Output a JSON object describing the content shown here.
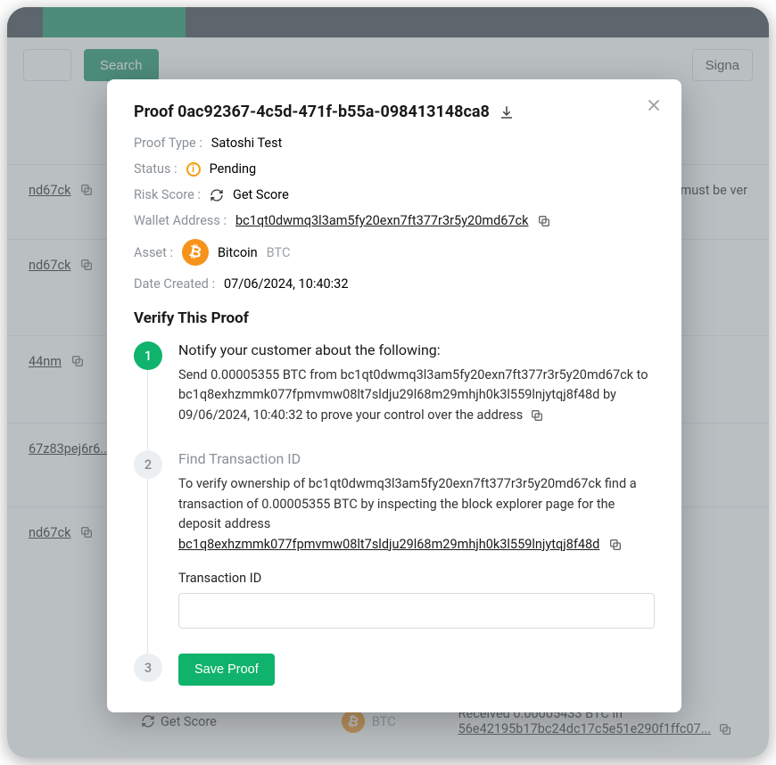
{
  "toolbar": {
    "search_button": "Search",
    "signa_button": "Signa"
  },
  "bg": {
    "addr1": "nd67ck",
    "must_verify": "ck must be ver",
    "addr2": "nd67ck",
    "addr3": "44nm",
    "addr4": "67z83pej6r6...",
    "addr5": "nd67ck",
    "get_score": "Get Score",
    "btc": "BTC",
    "received": "Received 0.00005433 BTC in",
    "txid": "56e42195b17bc24dc17c5e51e290f1ffc07..."
  },
  "modal": {
    "title": "Proof 0ac92367-4c5d-471f-b55a-098413148ca8",
    "proof_type_label": "Proof Type",
    "proof_type": "Satoshi Test",
    "status_label": "Status",
    "status": "Pending",
    "risk_label": "Risk Score",
    "risk_action": "Get Score",
    "wallet_label": "Wallet Address",
    "wallet": "bc1qt0dwmq3l3am5fy20exn7ft377r3r5y20md67ck",
    "asset_label": "Asset",
    "asset_name": "Bitcoin",
    "asset_ticker": "BTC",
    "date_label": "Date Created",
    "date": "07/06/2024, 10:40:32",
    "verify_title": "Verify This Proof",
    "step1_num": "1",
    "step1_title": "Notify your customer about the following:",
    "step1_text": "Send 0.00005355 BTC from bc1qt0dwmq3l3am5fy20exn7ft377r3r5y20md67ck to bc1q8exhzmmk077fpmvmw08lt7sldju29l68m29mhjh0k3l559lnjytqj8f48d by 09/06/2024, 10:40:32 to prove your control over the address",
    "step2_num": "2",
    "step2_title": "Find Transaction ID",
    "step2_text_a": "To verify ownership of bc1qt0dwmq3l3am5fy20exn7ft377r3r5y20md67ck find a transaction of 0.00005355 BTC by inspecting the block explorer page for the deposit address",
    "step2_link": "bc1q8exhzmmk077fpmvmw08lt7sldju29l68m29mhjh0k3l559lnjytqj8f48d",
    "txid_label": "Transaction ID",
    "step3_num": "3",
    "save_button": "Save Proof"
  }
}
